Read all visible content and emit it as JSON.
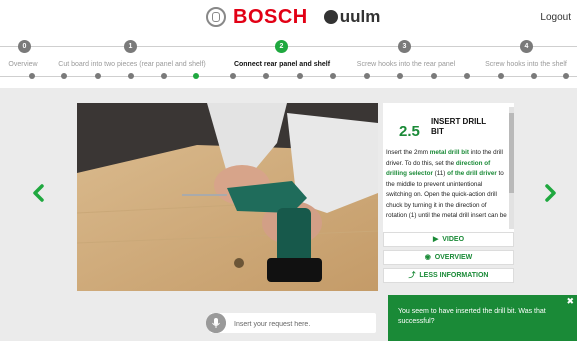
{
  "header": {
    "brand": "BOSCH",
    "partner": "uulm",
    "logout_label": "Logout"
  },
  "steps": [
    {
      "num": "0",
      "label": "Overview",
      "state": "done"
    },
    {
      "num": "1",
      "label": "Cut board into two pieces (rear panel and shelf)",
      "state": "done"
    },
    {
      "num": "2",
      "label": "Connect rear panel and shelf",
      "state": "active"
    },
    {
      "num": "3",
      "label": "Screw hooks into the rear panel",
      "state": "todo"
    },
    {
      "num": "4",
      "label": "Screw hooks into the shelf",
      "state": "todo"
    }
  ],
  "substep": {
    "number": "2.5",
    "title": "INSERT DRILL BIT",
    "text_parts": [
      "Insert the 2mm ",
      "metal drill bit",
      " into the drill driver. To do this, set the ",
      "direction of drilling selector",
      " (11) ",
      "of the drill driver",
      " to the middle to prevent unintentional switching on. Open the quick-action drill chuck by turning it in the direction of rotation (1) until the metal drill insert can be"
    ]
  },
  "actions": {
    "video_label": "VIDEO",
    "overview_label": "OVERVIEW",
    "less_info_label": "LESS INFORMATION"
  },
  "request": {
    "placeholder": "Insert your request here."
  },
  "toast": {
    "message": "You seem to have inserted the drill bit. Was that successful?"
  },
  "colors": {
    "accent_green": "#1a8a37",
    "brand_red": "#e20015"
  },
  "icons": {
    "video": "play-icon",
    "overview": "eye-icon",
    "less_info": "arrow-up-icon",
    "prev": "chevron-left-icon",
    "next": "chevron-right-icon",
    "mic": "microphone-icon"
  }
}
